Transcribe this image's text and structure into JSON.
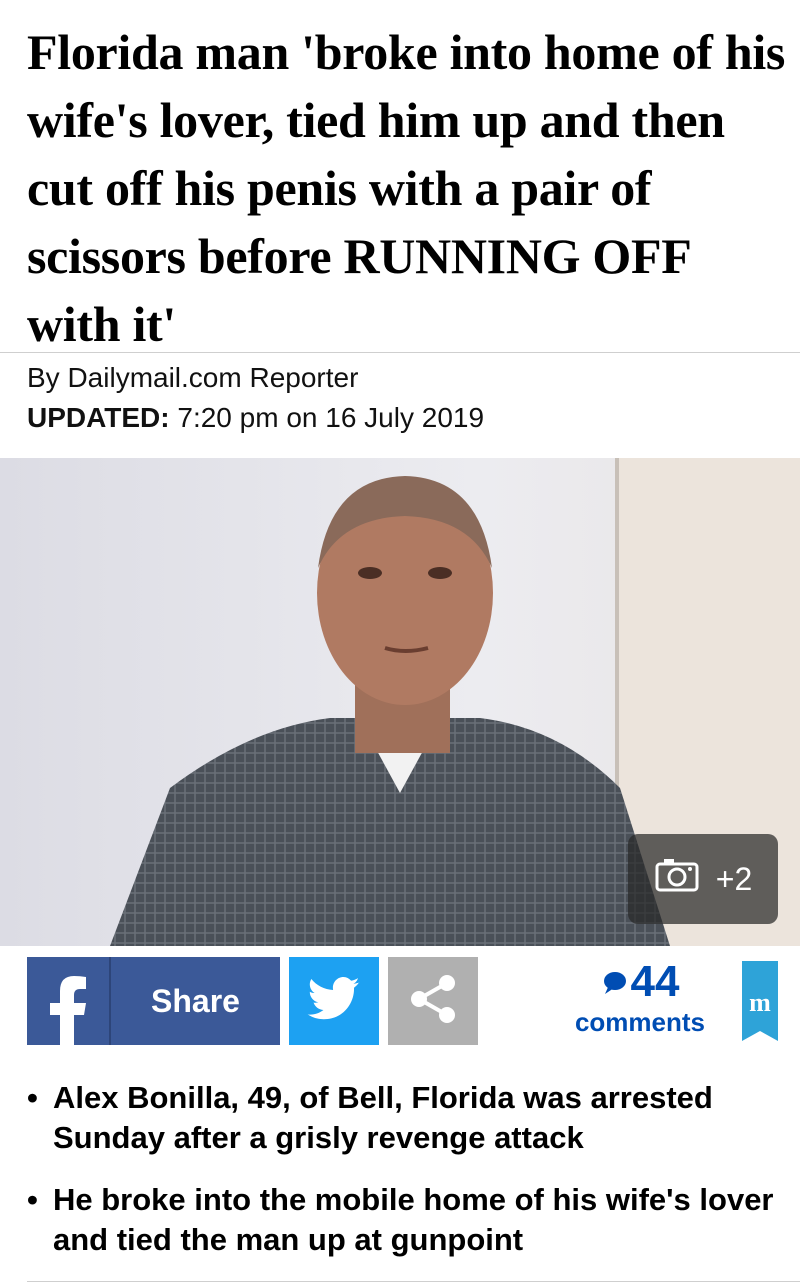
{
  "article": {
    "headline": "Florida man 'broke into home of his wife's lover, tied him up and then cut off his penis with a pair of scissors before RUNNING OFF with it'",
    "byline": "By Dailymail.com Reporter",
    "updated_label": "UPDATED:",
    "updated_value": "7:20 pm on 16 July 2019"
  },
  "photo": {
    "gallery_count": "+2",
    "gallery_icon": "camera-icon"
  },
  "share": {
    "facebook_label": "Share",
    "facebook_icon": "facebook-icon",
    "twitter_icon": "twitter-icon",
    "share_icon": "share-icon",
    "comments_count": "44",
    "comments_label": "comments",
    "logo_icon": "dailymail-logo-icon"
  },
  "bullets": [
    "Alex Bonilla, 49, of Bell, Florida was arrested Sunday after a grisly revenge attack",
    "He broke into the mobile home of his wife's lover and tied the man up at gunpoint"
  ],
  "colors": {
    "facebook": "#3b5998",
    "twitter": "#1da1f2",
    "share_gray": "#b0b0b0",
    "comments_blue": "#004db3",
    "logo_blue": "#2ea3d8"
  }
}
